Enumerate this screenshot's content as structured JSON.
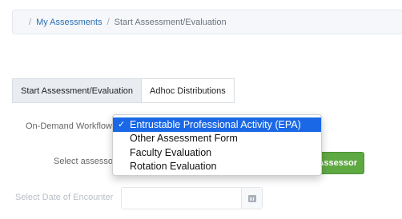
{
  "breadcrumb": {
    "separator": "/",
    "items": [
      {
        "label": "My Assessments"
      },
      {
        "label": "Start Assessment/Evaluation"
      }
    ]
  },
  "tabs": [
    {
      "label": "Start Assessment/Evaluation",
      "active": true
    },
    {
      "label": "Adhoc Distributions",
      "active": false
    }
  ],
  "form": {
    "workflow_label": "On-Demand Workflow",
    "assessor_label": "Select assessor",
    "assessor_button": "Assessor",
    "date_label": "Select Date of Encounter"
  },
  "workflow_dropdown": {
    "check_glyph": "✓",
    "selected_index": 0,
    "options": [
      "Entrustable Professional Activity (EPA)",
      "Other Assessment Form",
      "Faculty Evaluation",
      "Rotation Evaluation"
    ]
  },
  "icons": {
    "date_addon": "calendar-icon"
  },
  "colors": {
    "link": "#2a6fb3",
    "selected_option": "#1a68e6",
    "assessor_button": "#5fa943"
  }
}
